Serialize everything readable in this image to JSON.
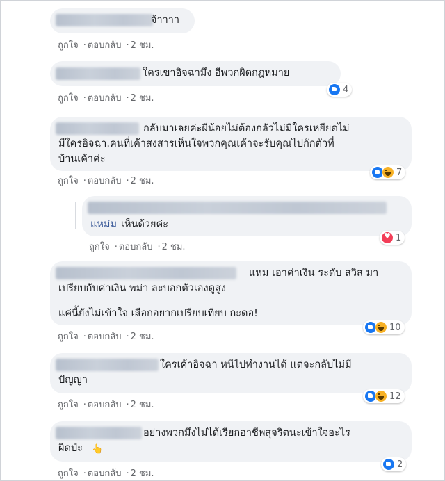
{
  "actions": {
    "like": "ถูกใจ",
    "reply": "ตอบกลับ"
  },
  "comments": [
    {
      "text": "จ้าาาา",
      "time": "2 ชม."
    },
    {
      "text": "ใครเขาอิจฉามึง อีพวกผิดกฎหมาย",
      "time": "2 ชม.",
      "reactions": {
        "icons": [
          "like"
        ],
        "count": "4"
      }
    },
    {
      "text": "กลับมาเลยค่ะผีน้อยไม่ต้องกลัวไม่มีใครเหยียดไม่\nมีใครอิจฉา.คนที่เค้าสงสารเห็นใจพวกคุณเค้าจะรับคุณไปกักตัวที่\nบ้านเค้าค่ะ",
      "time": "2 ชม.",
      "reactions": {
        "icons": [
          "like",
          "haha"
        ],
        "count": "7"
      }
    },
    {
      "author": "แหม่ม",
      "text": "เห็นด้วยค่ะ",
      "time": "2 ชม.",
      "reactions": {
        "icons": [
          "love"
        ],
        "count": "1"
      }
    },
    {
      "text": "แหม เอาค่าเงิน ระดับ สวิส มา\nเปรียบกับค่าเงิน พม่า ละบอกตัวเองดูสูง",
      "text2": "แค่นี้ยังไม่เข้าใจ เสือกอยากเปรียบเทียบ กะดอ!",
      "time": "2 ชม.",
      "reactions": {
        "icons": [
          "like",
          "haha"
        ],
        "count": "10"
      }
    },
    {
      "text": "ใครเค้าอิจฉา หนีไปทำงานได้ แต่จะกลับไม่มี\nปัญญา",
      "time": "2 ชม.",
      "reactions": {
        "icons": [
          "like",
          "haha"
        ],
        "count": "12"
      }
    },
    {
      "text": "อย่างพวกมึงไม่ได้เรียกอาชีพสุจริตนะเข้าใจอะไร\nผิดป่ะ",
      "emoji": "👆",
      "time": "2 ชม.",
      "reactions": {
        "icons": [
          "like"
        ],
        "count": "2"
      }
    }
  ]
}
